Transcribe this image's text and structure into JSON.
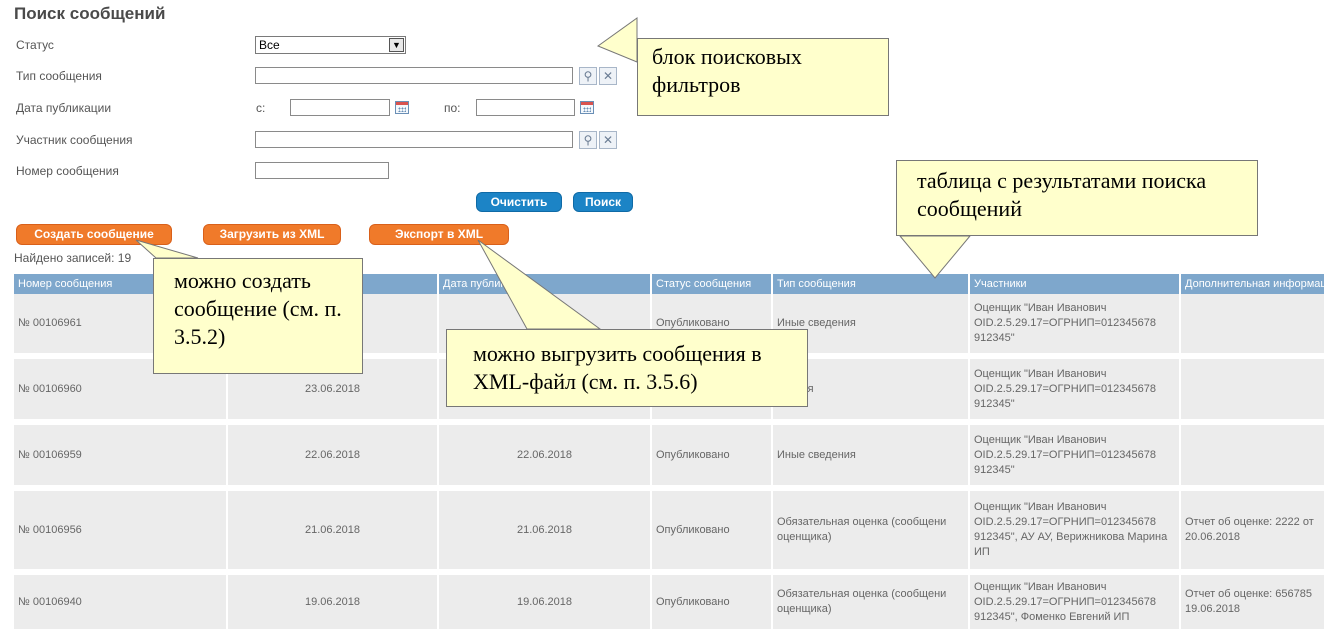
{
  "page_title": "Поиск сообщений",
  "filters": {
    "status_label": "Статус",
    "status_value": "Все",
    "type_label": "Тип сообщения",
    "date_label": "Дата публикации",
    "date_from_label": "с:",
    "date_to_label": "по:",
    "participant_label": "Участник сообщения",
    "number_label": "Номер сообщения"
  },
  "buttons": {
    "clear": "Очистить",
    "search": "Поиск",
    "create": "Создать сообщение",
    "load_xml": "Загрузить из XML",
    "export_xml": "Экспорт в XML"
  },
  "found_label": "Найдено записей: 19",
  "table": {
    "headers": [
      "Номер сообщения",
      "",
      "Дата публикации",
      "Статус сообщения",
      "Тип сообщения",
      "Участники",
      "Дополнительная информация"
    ],
    "rows": [
      {
        "number": "№ 00106961",
        "date1": "",
        "date2": "",
        "status": "Опубликовано",
        "type": "Иные сведения",
        "participants": "Оценщик \"Иван Иванович OID.2.5.29.17=ОГРНИП=012345678 912345\"",
        "extra": ""
      },
      {
        "number": "№ 00106960",
        "date1": "23.06.2018",
        "date2": "",
        "status": "",
        "type": "едения",
        "participants": "Оценщик \"Иван Иванович OID.2.5.29.17=ОГРНИП=012345678 912345\"",
        "extra": ""
      },
      {
        "number": "№ 00106959",
        "date1": "22.06.2018",
        "date2": "22.06.2018",
        "status": "Опубликовано",
        "type": "Иные сведения",
        "participants": "Оценщик \"Иван Иванович OID.2.5.29.17=ОГРНИП=012345678 912345\"",
        "extra": ""
      },
      {
        "number": "№ 00106956",
        "date1": "21.06.2018",
        "date2": "21.06.2018",
        "status": "Опубликовано",
        "type": "Обязательная оценка (сообщени оценщика)",
        "participants": "Оценщик \"Иван Иванович OID.2.5.29.17=ОГРНИП=012345678 912345\", АУ АУ, Верижникова Марина ИП",
        "extra": "Отчет об оценке: 2222 от 20.06.2018"
      },
      {
        "number": "№ 00106940",
        "date1": "19.06.2018",
        "date2": "19.06.2018",
        "status": "Опубликовано",
        "type": "Обязательная оценка (сообщени оценщика)",
        "participants": "Оценщик \"Иван Иванович OID.2.5.29.17=ОГРНИП=012345678 912345\", Фоменко Евгений ИП",
        "extra": "Отчет об оценке: 656785 19.06.2018"
      }
    ]
  },
  "callouts": {
    "filters": "блок поисковых фильтров",
    "table": "таблица с результатами поиска сообщений",
    "create": "можно создать сообщение (см. п. 3.5.2)",
    "export": "можно выгрузить сообщения в XML-файл (см. п. 3.5.6)"
  },
  "colors": {
    "header": "#7ea7cc",
    "blue_button": "#1c84c6",
    "orange_button": "#f07a2a",
    "callout_bg": "#ffffcc"
  }
}
